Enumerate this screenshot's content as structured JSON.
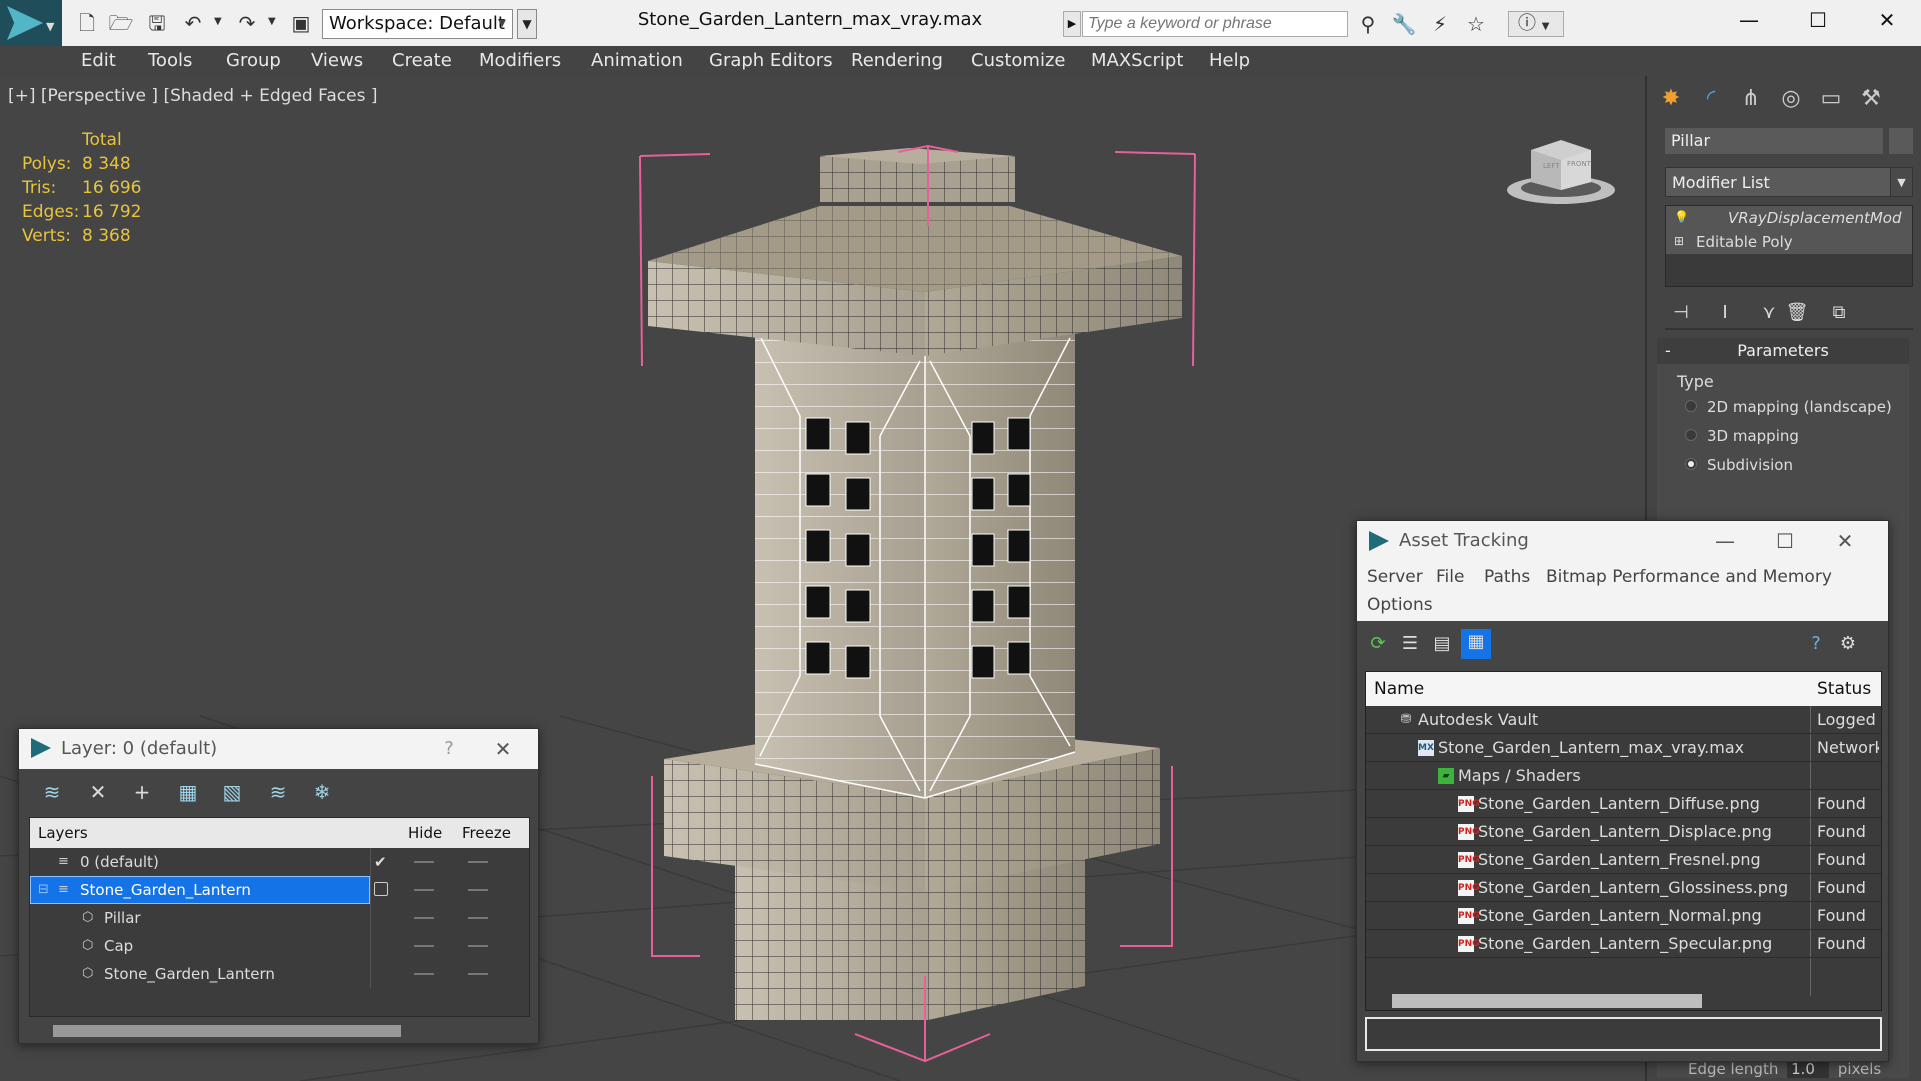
{
  "titlebar": {
    "workspace_label": "Workspace: Default",
    "file_title": "Stone_Garden_Lantern_max_vray.max",
    "search_placeholder": "Type a keyword or phrase"
  },
  "menu": [
    "Edit",
    "Tools",
    "Group",
    "Views",
    "Create",
    "Modifiers",
    "Animation",
    "Graph Editors",
    "Rendering",
    "Customize",
    "MAXScript",
    "Help"
  ],
  "viewport": {
    "label": "[+] [Perspective ] [Shaded + Edged Faces ]",
    "stats": {
      "header": "Total",
      "rows": [
        {
          "label": "Polys:",
          "value": "8 348"
        },
        {
          "label": "Tris:",
          "value": "16 696"
        },
        {
          "label": "Edges:",
          "value": "16 792"
        },
        {
          "label": "Verts:",
          "value": "8 368"
        }
      ]
    },
    "viewcube_top": "LEFT",
    "viewcube_front": "FRONT"
  },
  "command_panel": {
    "object_name": "Pillar",
    "modifier_list": "Modifier List",
    "stack": [
      "VRayDisplacementMod",
      "Editable Poly"
    ],
    "params_title": "Parameters",
    "params_minus": "-",
    "type_label": "Type",
    "type_options": [
      {
        "label": "2D mapping (landscape)",
        "selected": false
      },
      {
        "label": "3D mapping",
        "selected": false
      },
      {
        "label": "Subdivision",
        "selected": true
      }
    ],
    "edge_length_label": "Edge length",
    "edge_length_value": "1.0",
    "edge_length_unit": "pixels"
  },
  "layer_window": {
    "title": "Layer: 0 (default)",
    "help": "?",
    "close": "✕",
    "columns": {
      "layers": "Layers",
      "hide": "Hide",
      "freeze": "Freeze"
    },
    "rows": [
      {
        "name": "0 (default)",
        "level": 1,
        "type": "layer",
        "current": true,
        "selected": false
      },
      {
        "name": "Stone_Garden_Lantern",
        "level": 1,
        "type": "layer",
        "current": false,
        "selected": true
      },
      {
        "name": "Pillar",
        "level": 2,
        "type": "object",
        "current": false,
        "selected": false
      },
      {
        "name": "Cap",
        "level": 2,
        "type": "object",
        "current": false,
        "selected": false
      },
      {
        "name": "Stone_Garden_Lantern",
        "level": 2,
        "type": "object",
        "current": false,
        "selected": false
      }
    ]
  },
  "asset_window": {
    "title": "Asset Tracking",
    "menu": [
      "Server",
      "File",
      "Paths",
      "Bitmap Performance and Memory",
      "Options"
    ],
    "columns": {
      "name": "Name",
      "status": "Status"
    },
    "rows": [
      {
        "name": "Autodesk Vault",
        "status": "Logged Out",
        "level": 1,
        "icon": "vault"
      },
      {
        "name": "Stone_Garden_Lantern_max_vray.max",
        "status": "Network",
        "level": 2,
        "icon": "max"
      },
      {
        "name": "Maps / Shaders",
        "status": "",
        "level": 3,
        "icon": "maps"
      },
      {
        "name": "Stone_Garden_Lantern_Diffuse.png",
        "status": "Found",
        "level": 4,
        "icon": "png"
      },
      {
        "name": "Stone_Garden_Lantern_Displace.png",
        "status": "Found",
        "level": 4,
        "icon": "png"
      },
      {
        "name": "Stone_Garden_Lantern_Fresnel.png",
        "status": "Found",
        "level": 4,
        "icon": "png"
      },
      {
        "name": "Stone_Garden_Lantern_Glossiness.png",
        "status": "Found",
        "level": 4,
        "icon": "png"
      },
      {
        "name": "Stone_Garden_Lantern_Normal.png",
        "status": "Found",
        "level": 4,
        "icon": "png"
      },
      {
        "name": "Stone_Garden_Lantern_Specular.png",
        "status": "Found",
        "level": 4,
        "icon": "png"
      }
    ],
    "png_badge": "PNG"
  },
  "colors": {
    "stats_yellow": "#e8c43c",
    "selection_blue": "#1473e6",
    "bbox_pink": "#e8609a",
    "stone": "#b3aa98"
  }
}
